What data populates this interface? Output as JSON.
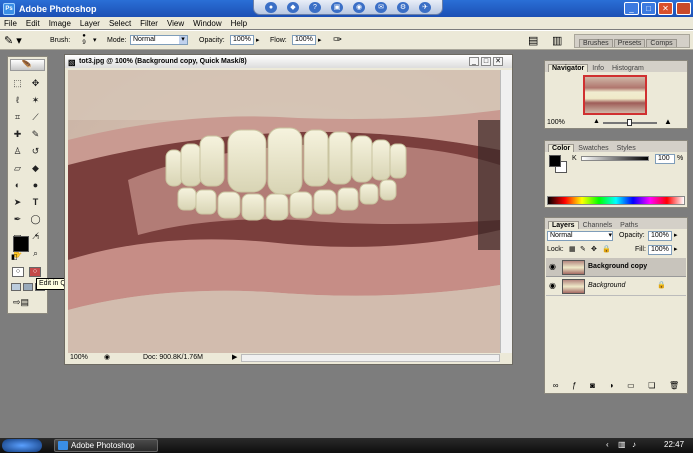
{
  "app": {
    "title": "Adobe Photoshop"
  },
  "menu": [
    "File",
    "Edit",
    "Image",
    "Layer",
    "Select",
    "Filter",
    "View",
    "Window",
    "Help"
  ],
  "options": {
    "brush_label": "Brush:",
    "brush_size": "9",
    "mode_label": "Mode:",
    "mode_value": "Normal",
    "opacity_label": "Opacity:",
    "opacity_value": "100%",
    "flow_label": "Flow:",
    "flow_value": "100%",
    "well_tabs": [
      "Brushes",
      "Presets",
      "Comps"
    ]
  },
  "tooltip": "Edit in Quick Mask Mode (Q)",
  "document": {
    "title": "tot3.jpg @ 100% (Background copy, Quick Mask/8)",
    "zoom": "100%",
    "doc_info": "Doc: 900.8K/1.76M"
  },
  "navigator": {
    "tabs": [
      "Navigator",
      "Info",
      "Histogram"
    ],
    "zoom": "100%"
  },
  "color": {
    "tabs": [
      "Color",
      "Swatches",
      "Styles"
    ],
    "channel_label": "K",
    "channel_value": "100",
    "channel_unit": "%"
  },
  "layers": {
    "tabs": [
      "Layers",
      "Channels",
      "Paths"
    ],
    "blend_mode": "Normal",
    "opacity_label": "Opacity:",
    "opacity_value": "100%",
    "lock_label": "Lock:",
    "fill_label": "Fill:",
    "fill_value": "100%",
    "items": [
      {
        "name": "Background copy"
      },
      {
        "name": "Background"
      }
    ]
  },
  "taskbar": {
    "item": "Adobe Photoshop",
    "time": "22:47"
  },
  "colors": {
    "titlebar": "#1c4fb4",
    "workspace": "#7d7d7d",
    "chrome": "#ece9d8",
    "quickmask": "#c44a4a"
  }
}
